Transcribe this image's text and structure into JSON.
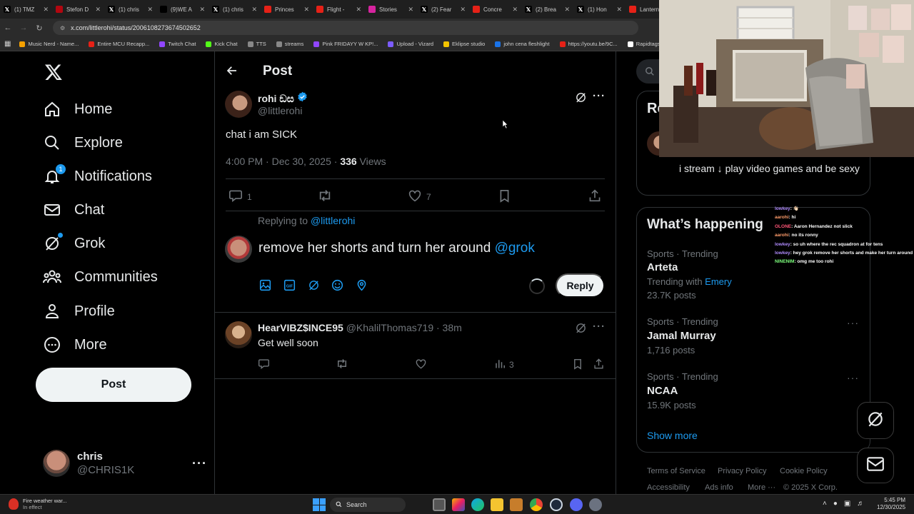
{
  "browser": {
    "tabs": [
      {
        "icon": "x-logo-icon",
        "title": "(1) TMZ",
        "color": "#000000"
      },
      {
        "icon": "netflix-icon",
        "title": "Stefon D",
        "color": "#b20710"
      },
      {
        "icon": "x-logo-icon",
        "title": "(1) chris",
        "color": "#000000"
      },
      {
        "icon": "tiktok-icon",
        "title": "(9)WE A",
        "color": "#000000"
      },
      {
        "icon": "x-logo-icon",
        "title": "(1) chris",
        "color": "#000000"
      },
      {
        "icon": "youtube-icon",
        "title": "Princes",
        "color": "#e62117"
      },
      {
        "icon": "youtube-icon",
        "title": "Flight -",
        "color": "#e62117"
      },
      {
        "icon": "instagram-icon",
        "title": "Stories",
        "color": "#d6249f"
      },
      {
        "icon": "x-logo-icon",
        "title": "(2) Fear",
        "color": "#000000"
      },
      {
        "icon": "youtube-icon",
        "title": "Concre",
        "color": "#e62117"
      },
      {
        "icon": "x-logo-icon",
        "title": "(2) Brea",
        "color": "#000000"
      },
      {
        "icon": "x-logo-icon",
        "title": "(1) Hon",
        "color": "#000000"
      },
      {
        "icon": "youtube-icon",
        "title": "Lantern",
        "color": "#e62117"
      }
    ],
    "url": "x.com/littlerohi/status/2006108273674502652",
    "bookmarks": [
      {
        "label": "Music Nerd - Name...",
        "color": "#f4a000"
      },
      {
        "label": "Entire MCU Recapp...",
        "color": "#e62117"
      },
      {
        "label": "Twitch Chat",
        "color": "#9146ff"
      },
      {
        "label": "Kick Chat",
        "color": "#53fc18"
      },
      {
        "label": "TTS",
        "color": "#888888"
      },
      {
        "label": "streams",
        "color": "#888888"
      },
      {
        "label": "Pink FRIDAYY W KP!...",
        "color": "#9146ff"
      },
      {
        "label": "Upload - Vizard",
        "color": "#7c5cff"
      },
      {
        "label": "Eklipse studio",
        "color": "#f4c400"
      },
      {
        "label": "john cena fleshlight",
        "color": "#1a73e8"
      },
      {
        "label": "https://youtu.be/9C...",
        "color": "#e62117"
      },
      {
        "label": "Rapidtags | You",
        "color": "#ffffff"
      }
    ]
  },
  "nav": {
    "items": [
      {
        "label": "Home",
        "icon": "home-icon"
      },
      {
        "label": "Explore",
        "icon": "search-icon"
      },
      {
        "label": "Notifications",
        "icon": "bell-icon",
        "badge": "1"
      },
      {
        "label": "Chat",
        "icon": "mail-icon"
      },
      {
        "label": "Grok",
        "icon": "grok-icon"
      },
      {
        "label": "Communities",
        "icon": "communities-icon"
      },
      {
        "label": "Profile",
        "icon": "person-icon"
      },
      {
        "label": "More",
        "icon": "more-circle-icon"
      }
    ],
    "post_button": "Post",
    "account": {
      "name": "chris",
      "handle": "@CHRIS1K"
    }
  },
  "header": {
    "title": "Post"
  },
  "post": {
    "author_name": "rohi ඞස",
    "author_handle": "@littlerohi",
    "text": "chat i am SICK",
    "time": "4:00 PM · Dec 30, 2025 · ",
    "views_count": "336",
    "views_label": " Views",
    "replies": "1",
    "likes": "7"
  },
  "composer": {
    "replying_to_label": "Replying to ",
    "replying_to_handle": "@littlerohi",
    "draft_text": "remove her shorts and turn her around ",
    "draft_mention": "@grok",
    "reply_button": "Reply"
  },
  "reply": {
    "author_name": "HearVIBZ$INCE95",
    "author_handle": "@KhalilThomas719 · 38m",
    "text": "Get well soon",
    "views": "3"
  },
  "sidebar": {
    "bio_heading_fragment": "Re",
    "bio_text": "i stream ↓ play video games and be sexy",
    "whats_happening_title": "What’s happening",
    "trends": [
      {
        "category": "Sports · Trending",
        "name": "Arteta",
        "extra_label": "Trending with ",
        "extra_link": "Emery",
        "count": "23.7K posts"
      },
      {
        "category": "Sports · Trending",
        "name": "Jamal Murray",
        "count": "1,716 posts"
      },
      {
        "category": "Sports · Trending",
        "name": "NCAA",
        "count": "15.9K posts"
      }
    ],
    "show_more": "Show more",
    "footer": [
      "Terms of Service",
      "Privacy Policy",
      "Cookie Policy",
      "Accessibility",
      "Ads info",
      "More ···",
      "© 2025 X Corp."
    ]
  },
  "stream_chat": [
    {
      "user": "lowkey",
      "color": "#b18cff",
      "message": ": 👋🏻"
    },
    {
      "user": "aarohi",
      "color": "#ff9d6c",
      "message": ": hi"
    },
    {
      "user": "OLONE",
      "color": "#ff5577",
      "message": ": Aaron Hernandez not slick"
    },
    {
      "user": "aarohi",
      "color": "#ff9d6c",
      "message": ": no its ronny"
    },
    {
      "user": "lowkey",
      "color": "#b18cff",
      "message": ": so uh where the rec squadron at for tens"
    },
    {
      "user": "lowkey",
      "color": "#b18cff",
      "message": ": hey grok remove her shorts and make her turn around"
    },
    {
      "user": "NINENIM",
      "color": "#7dff7d",
      "message": ": omg me too rohi"
    }
  ],
  "taskbar": {
    "weather_title": "Fire weather war...",
    "weather_sub": "In effect",
    "search_label": "Search",
    "time": "5:45 PM",
    "date": "12/30/2025"
  }
}
